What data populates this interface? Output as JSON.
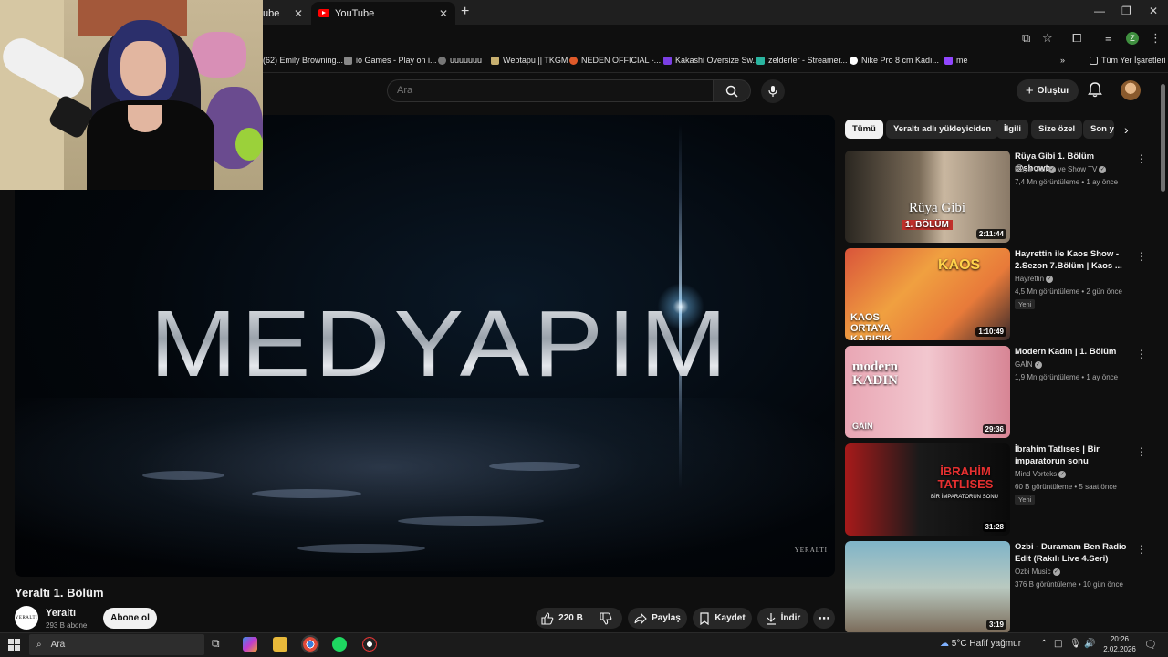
{
  "browser": {
    "tabs": [
      {
        "label": "ube"
      },
      {
        "label": "YouTube"
      }
    ],
    "new_tab_symbol": "+",
    "close_symbol": "✕",
    "window_controls": [
      "—",
      "❐",
      "✕"
    ],
    "bookmarks": [
      {
        "label": "(62) Emily Browning...",
        "icon_color": "#e0e0e0"
      },
      {
        "label": "io Games - Play on i...",
        "icon_color": "#a0a0a0"
      },
      {
        "label": "uuuuuuu",
        "icon_color": "#a0a0a0"
      },
      {
        "label": "Webtapu || TKGM",
        "icon_color": "#c8b070"
      },
      {
        "label": "NEDEN OFFICIAL -...",
        "icon_color": "#e05a2a"
      },
      {
        "label": "Kakashi Oversize Sw...",
        "icon_color": "#7b3fe4"
      },
      {
        "label": "zelderler - Streamer...",
        "icon_color": "#2ab5a0"
      },
      {
        "label": "Nike Pro 8 cm Kadı...",
        "icon_color": "#ffffff"
      },
      {
        "label": "me",
        "icon_color": "#9146ff"
      }
    ],
    "all_bookmarks": "Tüm Yer İşaretleri",
    "profile_initial": "Z"
  },
  "header": {
    "search_placeholder": "Ara",
    "create_label": "Oluştur"
  },
  "player": {
    "logo_text": "MEDYAPIM",
    "watermark": "YERALTI"
  },
  "video": {
    "title": "Yeraltı 1. Bölüm",
    "channel_name": "Yeraltı",
    "channel_avatar_text": "YERALTI",
    "subscribers": "293 B abone",
    "subscribe_label": "Abone ol",
    "likes": "220 B",
    "share_label": "Paylaş",
    "save_label": "Kaydet",
    "download_label": "İndir"
  },
  "chips": [
    "Tümü",
    "Yeraltı adlı yükleyiciden",
    "İlgili",
    "Size özel",
    "Son y"
  ],
  "recommendations": [
    {
      "title": "Rüya Gibi 1. Bölüm @showtv",
      "channel": "Rüya Gibi",
      "channel_extra": "ve Show TV",
      "meta": "7,4 Mn görüntüleme • 1 ay önce",
      "duration": "2:11:44",
      "badge": "",
      "thumb_text": "Rüya Gibi",
      "thumb_sub": "1. BÖLÜM"
    },
    {
      "title": "Hayrettin ile Kaos Show - 2.Sezon 7.Bölüm | Kaos ...",
      "channel": "Hayrettin",
      "channel_extra": "",
      "meta": "4,5 Mn görüntüleme • 2 gün önce",
      "duration": "1:10:49",
      "badge": "Yeni",
      "thumb_text": "KAOS",
      "thumb_sub": "ORTAYA KARIŞIK"
    },
    {
      "title": "Modern Kadın | 1. Bölüm",
      "channel": "GAİN",
      "channel_extra": "",
      "meta": "1,9 Mn görüntüleme • 1 ay önce",
      "duration": "29:36",
      "badge": "",
      "thumb_text": "modern KADIN",
      "thumb_sub": "GAİN"
    },
    {
      "title": "İbrahim Tatlıses | Bir imparatorun sonu",
      "channel": "Mind Vorteks",
      "channel_extra": "",
      "meta": "60 B görüntüleme • 5 saat önce",
      "duration": "31:28",
      "badge": "Yeni",
      "thumb_text": "İBRAHİM TATLISES",
      "thumb_sub": "BİR İMPARATORUN SONU"
    },
    {
      "title": "Ozbi - Duramam Ben Radio Edit (Rakılı Live 4.Seri)",
      "channel": "Ozbi Music",
      "channel_extra": "",
      "meta": "376 B görüntüleme • 10 gün önce",
      "duration": "3:19",
      "badge": "",
      "thumb_text": "",
      "thumb_sub": ""
    }
  ],
  "taskbar": {
    "search_placeholder": "Ara",
    "weather": "5°C  Hafif yağmur",
    "time": "20:26",
    "date": "2.02.2026"
  }
}
